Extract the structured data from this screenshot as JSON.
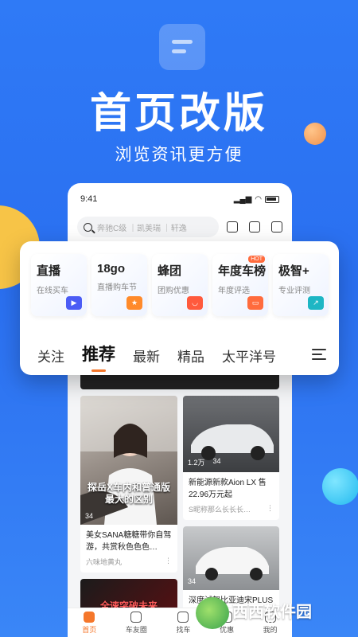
{
  "promo": {
    "headline": "首页改版",
    "subheadline": "浏览资讯更方便"
  },
  "phone": {
    "status_time": "9:41",
    "search_placeholder": "奔驰C级 ｜凯美瑞 ｜轩逸"
  },
  "categories": [
    {
      "title": "直播",
      "subtitle": "在线买车",
      "icon": "play-icon",
      "color": "#4b5cf5"
    },
    {
      "title": "18go",
      "subtitle": "直播购车节",
      "icon": "star-icon",
      "color": "#ff8a2a"
    },
    {
      "title": "蜂团",
      "subtitle": "团购优惠",
      "icon": "bag-icon",
      "color": "#ff5a3d"
    },
    {
      "title": "年度车榜",
      "subtitle": "年度评选",
      "icon": "ticket-icon",
      "color": "#ff6b3d",
      "badge": "HOT"
    },
    {
      "title": "极智+",
      "subtitle": "专业评测",
      "icon": "chart-icon",
      "color": "#1db6c4"
    }
  ],
  "tabs": [
    "关注",
    "推荐",
    "最新",
    "精品",
    "太平洋号"
  ],
  "feed": {
    "left": [
      {
        "caption": "探岳X车内和普通版最大的区别",
        "comments": "34",
        "title": "美女SANA糖糖带你自驾游，共赏秋色色色…",
        "author": "六味地黄丸"
      },
      {
        "caption": "全速突破未来",
        "comments": "",
        "title": "",
        "author": ""
      }
    ],
    "right": [
      {
        "views": "1.2万",
        "comments": "34",
        "title": "新能源新款Aion LX 售22.96万元起",
        "author": "S昵称那么长长长…"
      },
      {
        "views": "",
        "comments": "34",
        "title": "深度试驾比亚迪宋PLUS 唯有…",
        "author": ""
      }
    ]
  },
  "bottom_nav": [
    "首页",
    "车友圈",
    "找车",
    "优惠",
    "我的"
  ],
  "watermark": {
    "text": "西西软件园",
    "url_text": "CR173.COM"
  }
}
